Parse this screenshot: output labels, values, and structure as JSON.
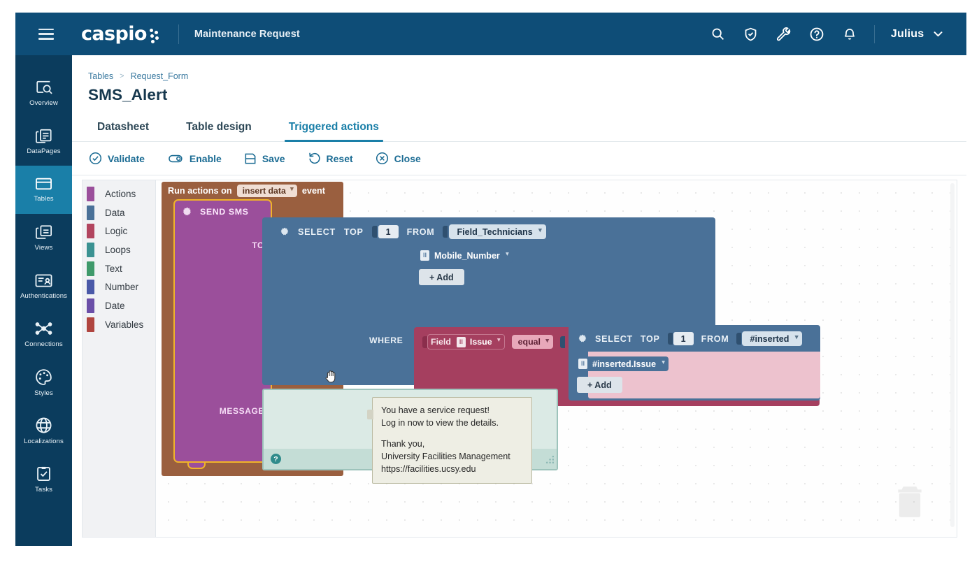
{
  "topbar": {
    "menu_icon": "hamburger-icon",
    "brand": "caspio",
    "app_title": "Maintenance Request",
    "icons": [
      "search-icon",
      "shield-check-icon",
      "wrench-icon",
      "help-circle-icon",
      "bell-icon"
    ],
    "user": "Julius",
    "accent": "#0e4d77"
  },
  "sidebar": {
    "items": [
      {
        "label": "Overview",
        "icon": "overview-search-icon",
        "active": false
      },
      {
        "label": "DataPages",
        "icon": "datapages-icon",
        "active": false
      },
      {
        "label": "Tables",
        "icon": "tables-icon",
        "active": true
      },
      {
        "label": "Views",
        "icon": "views-icon",
        "active": false
      },
      {
        "label": "Authentications",
        "icon": "authentications-icon",
        "active": false
      },
      {
        "label": "Connections",
        "icon": "connections-icon",
        "active": false
      },
      {
        "label": "Styles",
        "icon": "styles-palette-icon",
        "active": false
      },
      {
        "label": "Localizations",
        "icon": "globe-icon",
        "active": false
      },
      {
        "label": "Tasks",
        "icon": "tasks-clipboard-icon",
        "active": false
      }
    ],
    "active_color": "#1a7fa8",
    "bg": "#0b3c5d"
  },
  "breadcrumb": {
    "root": "Tables",
    "separator": ">",
    "current": "Request_Form"
  },
  "page_title": "SMS_Alert",
  "tabs": [
    {
      "label": "Datasheet",
      "active": false
    },
    {
      "label": "Table design",
      "active": false
    },
    {
      "label": "Triggered actions",
      "active": true
    }
  ],
  "toolbar": [
    {
      "label": "Validate",
      "icon": "check-circle-icon"
    },
    {
      "label": "Enable",
      "icon": "toggle-switch-icon"
    },
    {
      "label": "Save",
      "icon": "floppy-disk-icon"
    },
    {
      "label": "Reset",
      "icon": "undo-arrow-icon"
    },
    {
      "label": "Close",
      "icon": "x-circle-icon"
    }
  ],
  "palette": [
    {
      "label": "Actions",
      "color": "#9b4f9b"
    },
    {
      "label": "Data",
      "color": "#4a7198"
    },
    {
      "label": "Logic",
      "color": "#b2455f"
    },
    {
      "label": "Loops",
      "color": "#3b9292"
    },
    {
      "label": "Text",
      "color": "#3f9a6b"
    },
    {
      "label": "Number",
      "color": "#4a59a8"
    },
    {
      "label": "Date",
      "color": "#6b4fa8"
    },
    {
      "label": "Variables",
      "color": "#b0453f"
    }
  ],
  "canvas": {
    "trigger": {
      "prefix": "Run actions on",
      "event_value": "insert data",
      "suffix": "event",
      "color": "#9a5f3f"
    },
    "action": {
      "name": "SEND SMS",
      "gear_icon": "gear-icon",
      "color": "#9b4f9b",
      "selected_outline": "#f0b429",
      "ports": {
        "to": "TO",
        "message": "MESSAGE"
      }
    },
    "select_to": {
      "keywords": {
        "select": "SELECT",
        "top": "TOP",
        "from": "FROM"
      },
      "top_value": "1",
      "table": "Field_Technicians",
      "columns": [
        "Mobile_Number"
      ],
      "add_label": "+ Add",
      "where_label": "WHERE",
      "color": "#4a7198"
    },
    "condition": {
      "field_word": "Field",
      "field": "Issue",
      "operator": "equal",
      "color": "#a53f5f",
      "nested_select": {
        "keywords": {
          "select": "SELECT",
          "top": "TOP",
          "from": "FROM"
        },
        "top_value": "1",
        "table": "#inserted",
        "columns": [
          "#inserted.Issue"
        ],
        "add_label": "+ Add"
      }
    },
    "message_box": {
      "help_icon": "question-mark-icon",
      "resize_icon": "resize-handle-icon",
      "color": "#dbeae5"
    },
    "tooltip": {
      "line1": "You have a service request!",
      "line2": "Log in now to view the details.",
      "line3": "Thank you,",
      "line4": "University Facilities Management",
      "line5": "https://facilities.ucsy.edu"
    },
    "trash_icon": "trash-can-icon",
    "cursor_icon": "grab-hand-cursor"
  }
}
